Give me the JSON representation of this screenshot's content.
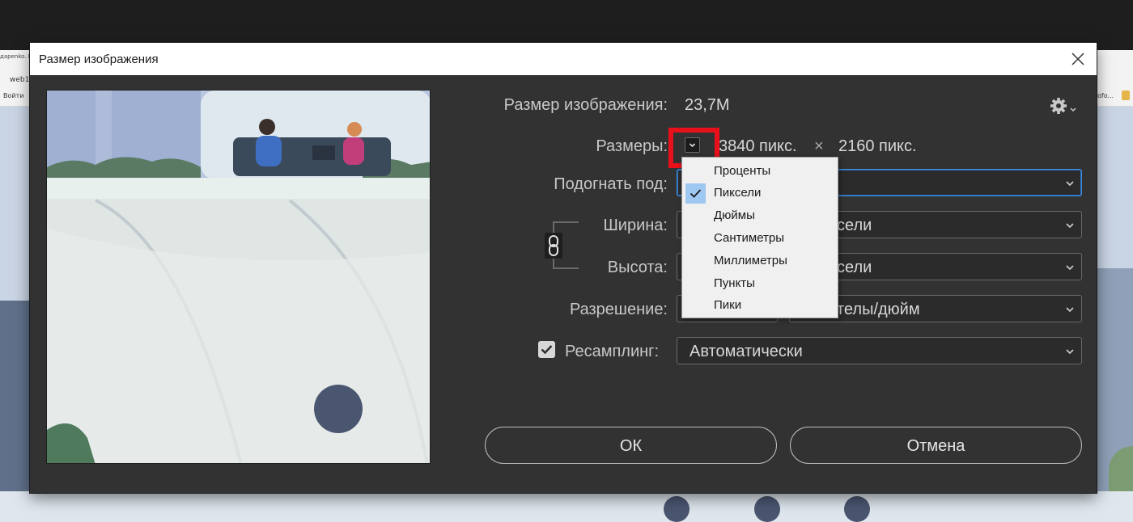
{
  "background": {
    "tab_text": "дарenko. K",
    "url_text": "web1.",
    "bookmark_text": "Войти",
    "right_text": "ofo..."
  },
  "dialog": {
    "title": "Размер изображения",
    "image_size_label": "Размер изображения:",
    "image_size_value": "23,7M",
    "dimensions_label": "Размеры:",
    "dimensions_width": "3840 пикс.",
    "dimensions_sep": "×",
    "dimensions_height": "2160 пикс.",
    "fit_label": "Подогнать под:",
    "width_label": "Ширина:",
    "width_unit_visible": "сели",
    "height_label": "Высота:",
    "height_unit_visible": "сели",
    "resolution_label": "Разрешение:",
    "resolution_unit_visible": "телы/дюйм",
    "resample_label": "Ресамплинг:",
    "resample_checked": true,
    "resample_value": "Автоматически",
    "ok_label": "ОК",
    "cancel_label": "Отмена"
  },
  "units_menu": {
    "items": [
      "Проценты",
      "Пиксели",
      "Дюймы",
      "Сантиметры",
      "Миллиметры",
      "Пункты",
      "Пики"
    ],
    "selected_index": 1
  },
  "icons": {
    "close": "close-icon",
    "gear": "gear-icon",
    "link": "link-icon",
    "check": "check-icon",
    "chevron": "chevron-down-icon"
  },
  "colors": {
    "dialog_bg": "#323232",
    "accent_focus": "#3e8ee0",
    "highlight": "#e8101a",
    "menu_selected": "#9ec8f2"
  }
}
